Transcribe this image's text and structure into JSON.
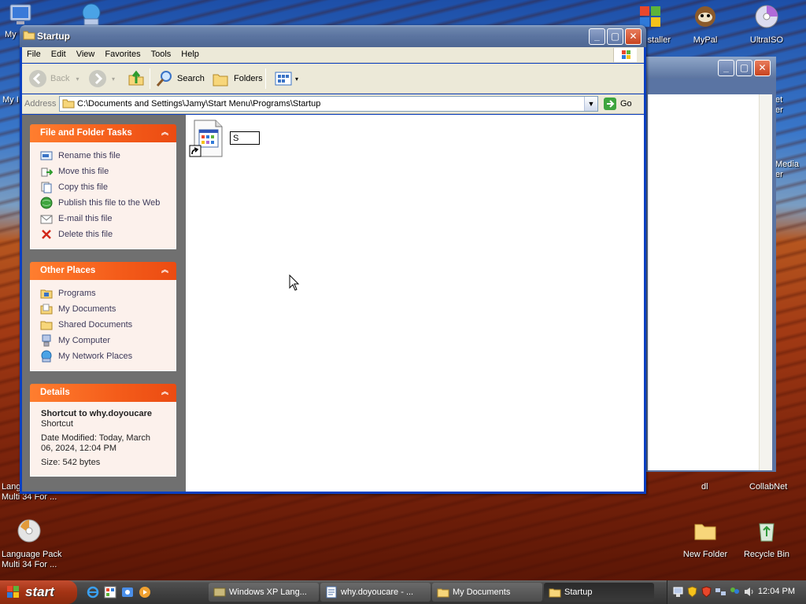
{
  "desktop": {
    "icons": [
      {
        "label": "My"
      },
      {
        "label": "My I"
      },
      {
        "label": "staller"
      },
      {
        "label": "MyPal"
      },
      {
        "label": "UltraISO"
      },
      {
        "label": "et\ner"
      },
      {
        "label": "Media\ner"
      },
      {
        "label": "Lang\nMulti 34 For ..."
      },
      {
        "label": "dl"
      },
      {
        "label": "CollabNet"
      },
      {
        "label": "Language Pack\nMulti 34 For ..."
      },
      {
        "label": "New Folder"
      },
      {
        "label": "Recycle Bin"
      }
    ]
  },
  "window": {
    "title": "Startup",
    "menu": [
      "File",
      "Edit",
      "View",
      "Favorites",
      "Tools",
      "Help"
    ],
    "toolbar": {
      "back": "Back",
      "search": "Search",
      "folders": "Folders"
    },
    "address": {
      "label": "Address",
      "path": "C:\\Documents and Settings\\Jamy\\Start Menu\\Programs\\Startup",
      "go": "Go"
    },
    "file_tasks": {
      "title": "File and Folder Tasks",
      "items": [
        "Rename this file",
        "Move this file",
        "Copy this file",
        "Publish this file to the Web",
        "E-mail this file",
        "Delete this file"
      ]
    },
    "other_places": {
      "title": "Other Places",
      "items": [
        "Programs",
        "My Documents",
        "Shared Documents",
        "My Computer",
        "My Network Places"
      ]
    },
    "details": {
      "title": "Details",
      "name": "Shortcut to why.doyoucare",
      "type": "Shortcut",
      "modified_line1": "Date Modified: Today, March",
      "modified_line2": "06, 2024, 12:04 PM",
      "size": "Size: 542 bytes"
    },
    "file": {
      "rename_value": "S"
    }
  },
  "taskbar": {
    "start": "start",
    "tasks": [
      "Windows XP Lang...",
      "why.doyoucare - ...",
      "My Documents",
      "Startup"
    ],
    "active_task": "Startup",
    "clock": "12:04 PM"
  }
}
